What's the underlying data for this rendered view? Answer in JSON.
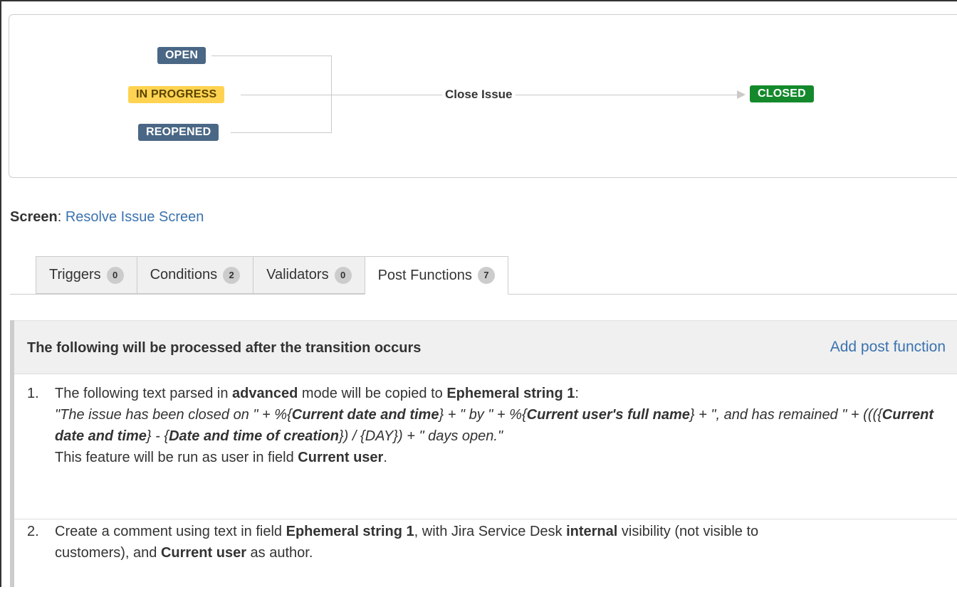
{
  "diagram": {
    "statuses": {
      "open": "OPEN",
      "in_progress": "IN PROGRESS",
      "reopened": "REOPENED",
      "closed": "CLOSED"
    },
    "transition_label": "Close Issue",
    "colors": {
      "todo": "#4a6785",
      "in_progress": "#ffd351",
      "done": "#14892c",
      "line": "#c9c9c9"
    }
  },
  "screen": {
    "label": "Screen",
    "value": "Resolve Issue Screen"
  },
  "tabs": [
    {
      "label": "Triggers",
      "count": "0"
    },
    {
      "label": "Conditions",
      "count": "2"
    },
    {
      "label": "Validators",
      "count": "0"
    },
    {
      "label": "Post Functions",
      "count": "7"
    }
  ],
  "panel": {
    "title": "The following will be processed after the transition occurs",
    "add_link": "Add post function",
    "items": [
      {
        "number": "1.",
        "p1": "The following text parsed in ",
        "b1": "advanced",
        "p2": " mode will be copied to ",
        "b2": "Ephemeral string 1",
        "p3": ":",
        "e1": "\"The issue has been closed on \" + %{",
        "eb1": "Current date and time",
        "e2": "} + \" by \" + %{",
        "eb2": "Current user's full name",
        "e3": "} + \", and has remained \" + ((({",
        "eb3": "Current date and time",
        "e4": "} - {",
        "eb4": "Date and time of creation",
        "e5": "}) / {DAY}) + \" days open.\"",
        "run_prefix": "This feature will be run as user in field ",
        "run_user": "Current user",
        "run_suffix": "."
      },
      {
        "number": "2.",
        "p1": "Create a comment using text in field ",
        "b1": "Ephemeral string 1",
        "p2": ", with Jira Service Desk ",
        "b2": "internal",
        "p3": " visibility (not visible to customers), and ",
        "b3": "Current user",
        "p4": " as author."
      }
    ]
  }
}
